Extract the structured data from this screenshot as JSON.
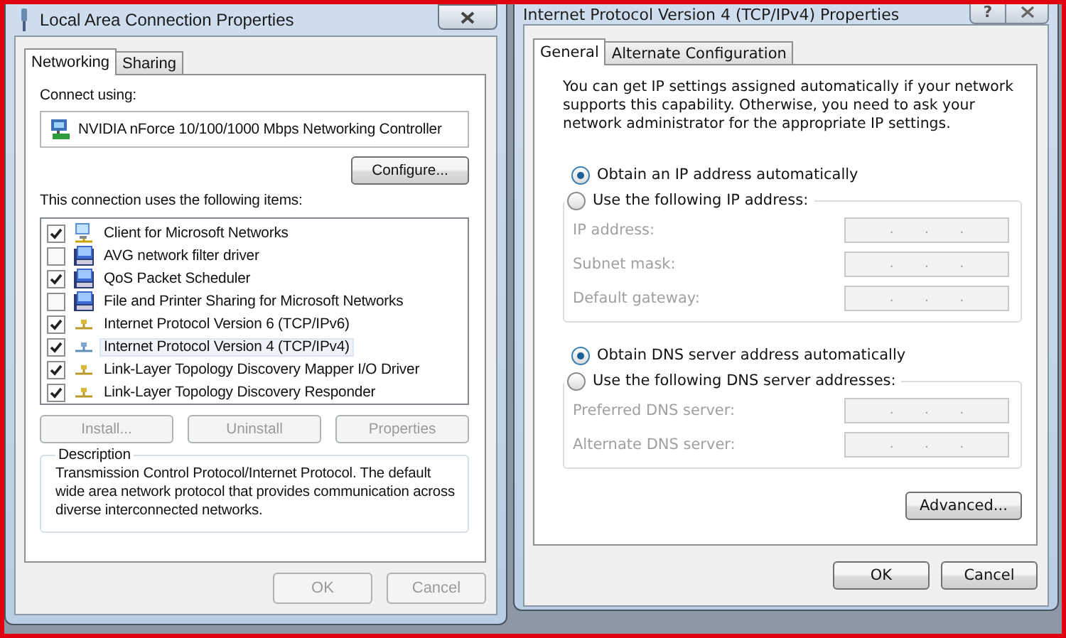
{
  "left_window": {
    "title": "Local Area Connection Properties",
    "tabs": [
      {
        "label": "Networking",
        "selected": true
      },
      {
        "label": "Sharing",
        "selected": false
      }
    ],
    "connect_using_label": "Connect using:",
    "adapter": "NVIDIA nForce 10/100/1000 Mbps Networking Controller",
    "configure_button": {
      "label": "Configure...",
      "disabled": false
    },
    "items_label": "This connection uses the following items:",
    "items": [
      {
        "label": "Client for Microsoft Networks",
        "checked": true,
        "selected": false,
        "kind": "client"
      },
      {
        "label": "AVG network filter driver",
        "checked": false,
        "selected": false,
        "kind": "service"
      },
      {
        "label": "QoS Packet Scheduler",
        "checked": true,
        "selected": false,
        "kind": "service"
      },
      {
        "label": "File and Printer Sharing for Microsoft Networks",
        "checked": false,
        "selected": false,
        "kind": "service"
      },
      {
        "label": "Internet Protocol Version 6 (TCP/IPv6)",
        "checked": true,
        "selected": false,
        "kind": "protocol"
      },
      {
        "label": "Internet Protocol Version 4 (TCP/IPv4)",
        "checked": true,
        "selected": true,
        "kind": "protocol"
      },
      {
        "label": "Link-Layer Topology Discovery Mapper I/O Driver",
        "checked": true,
        "selected": false,
        "kind": "protocol"
      },
      {
        "label": "Link-Layer Topology Discovery Responder",
        "checked": true,
        "selected": false,
        "kind": "protocol"
      }
    ],
    "item_buttons": [
      {
        "label": "Install...",
        "disabled": true
      },
      {
        "label": "Uninstall",
        "disabled": true
      },
      {
        "label": "Properties",
        "disabled": true
      }
    ],
    "description": {
      "title": "Description",
      "text": "Transmission Control Protocol/Internet Protocol. The default wide area network protocol that provides communication across diverse interconnected networks."
    },
    "buttons": [
      {
        "label": "OK",
        "disabled": true
      },
      {
        "label": "Cancel",
        "disabled": true
      }
    ]
  },
  "right_window": {
    "title": "Internet Protocol Version 4 (TCP/IPv4) Properties",
    "help_button": "?",
    "tabs": [
      {
        "label": "General",
        "selected": true
      },
      {
        "label": "Alternate Configuration",
        "selected": false
      }
    ],
    "intro": "You can get IP settings assigned automatically if your network supports this capability. Otherwise, you need to ask your network administrator for the appropriate IP settings.",
    "sections": [
      {
        "options": [
          {
            "label": "Obtain an IP address automatically",
            "selected": true,
            "kind": "plain"
          },
          {
            "label": "Use the following IP address:",
            "selected": false,
            "kind": "group",
            "fields": [
              {
                "label": "IP address:",
                "disabled": true,
                "separators": [
                  ".",
                  ".",
                  "."
                ]
              },
              {
                "label": "Subnet mask:",
                "disabled": true,
                "separators": [
                  ".",
                  ".",
                  "."
                ]
              },
              {
                "label": "Default gateway:",
                "disabled": true,
                "separators": [
                  ".",
                  ".",
                  "."
                ]
              }
            ]
          }
        ]
      },
      {
        "options": [
          {
            "label": "Obtain DNS server address automatically",
            "selected": true,
            "kind": "plain"
          },
          {
            "label": "Use the following DNS server addresses:",
            "selected": false,
            "kind": "group",
            "fields": [
              {
                "label": "Preferred DNS server:",
                "disabled": true,
                "separators": [
                  ".",
                  ".",
                  "."
                ]
              },
              {
                "label": "Alternate DNS server:",
                "disabled": true,
                "separators": [
                  ".",
                  ".",
                  "."
                ]
              }
            ]
          }
        ]
      }
    ],
    "advanced_button": {
      "label": "Advanced...",
      "disabled": false
    },
    "buttons": [
      {
        "label": "OK",
        "disabled": false
      },
      {
        "label": "Cancel",
        "disabled": false
      }
    ]
  }
}
